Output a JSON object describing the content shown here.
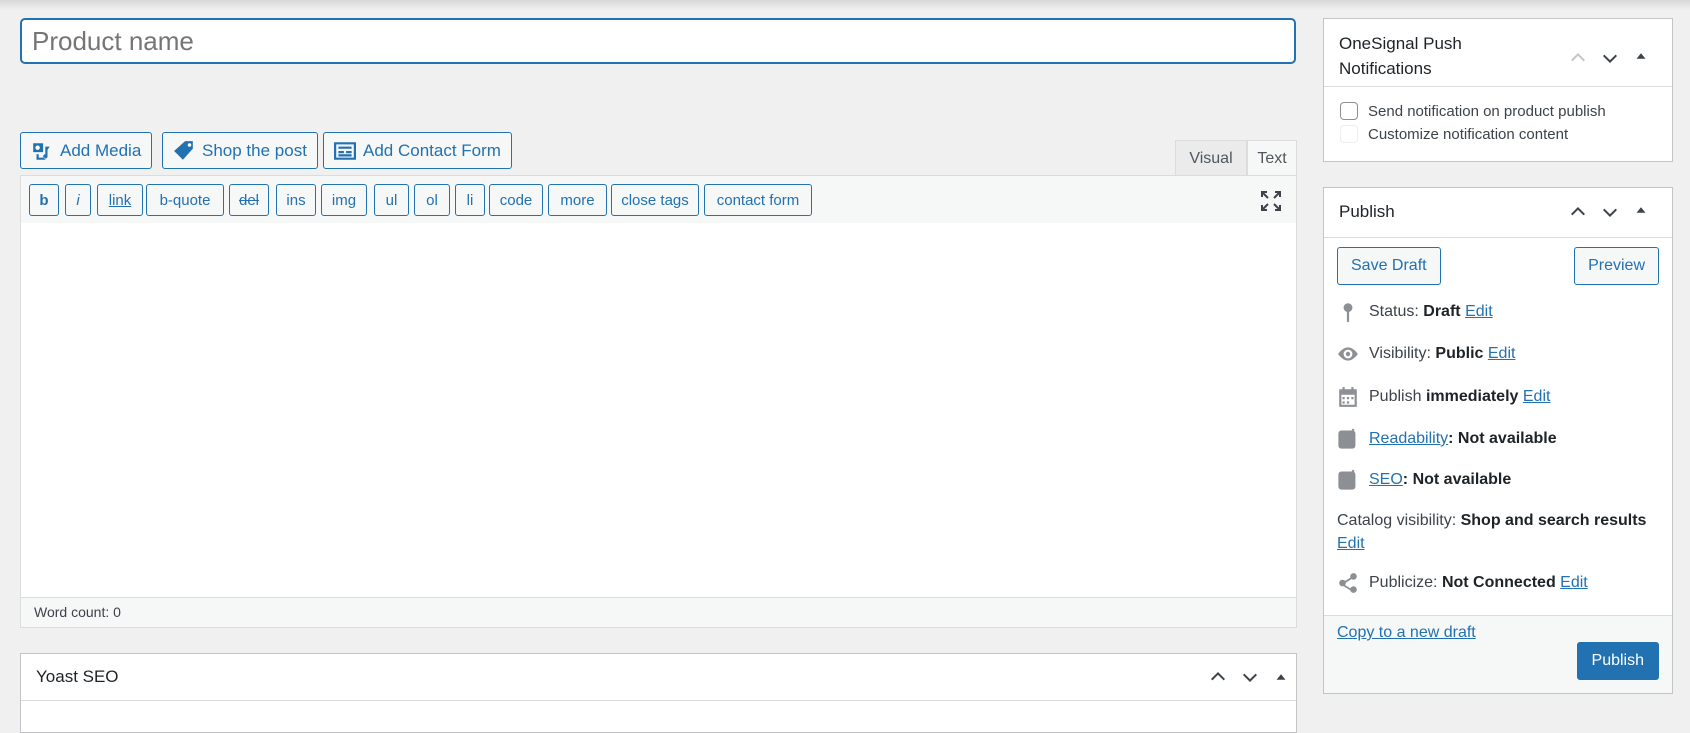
{
  "title": {
    "placeholder": "Product name"
  },
  "media_buttons": [
    {
      "label": "Add Media"
    },
    {
      "label": "Shop the post"
    },
    {
      "label": "Add Contact Form"
    }
  ],
  "tabs": {
    "visual": "Visual",
    "text": "Text"
  },
  "quicktags": [
    "b",
    "i",
    "link",
    "b-quote",
    "del",
    "ins",
    "img",
    "ul",
    "ol",
    "li",
    "code",
    "more",
    "close tags",
    "contact form"
  ],
  "word_count": "Word count: 0",
  "yoast": {
    "title": "Yoast SEO"
  },
  "onesignal": {
    "title": "OneSignal Push Notifications",
    "options": [
      "Send notification on product publish",
      "Customize notification content"
    ]
  },
  "publish": {
    "title": "Publish",
    "save_draft": "Save Draft",
    "preview": "Preview",
    "status_label": "Status:",
    "status_value": "Draft",
    "visibility_label": "Visibility:",
    "visibility_value": "Public",
    "publish_label": "Publish",
    "publish_value": "immediately",
    "readability_link": "Readability",
    "readability_value": ": Not available",
    "seo_link": "SEO",
    "seo_value": ": Not available",
    "catalog_label": "Catalog visibility:",
    "catalog_value": "Shop and search results",
    "publicize_label": "Publicize:",
    "publicize_value": "Not Connected",
    "edit": "Edit",
    "copy_draft": "Copy to a new draft",
    "publish_button": "Publish"
  }
}
